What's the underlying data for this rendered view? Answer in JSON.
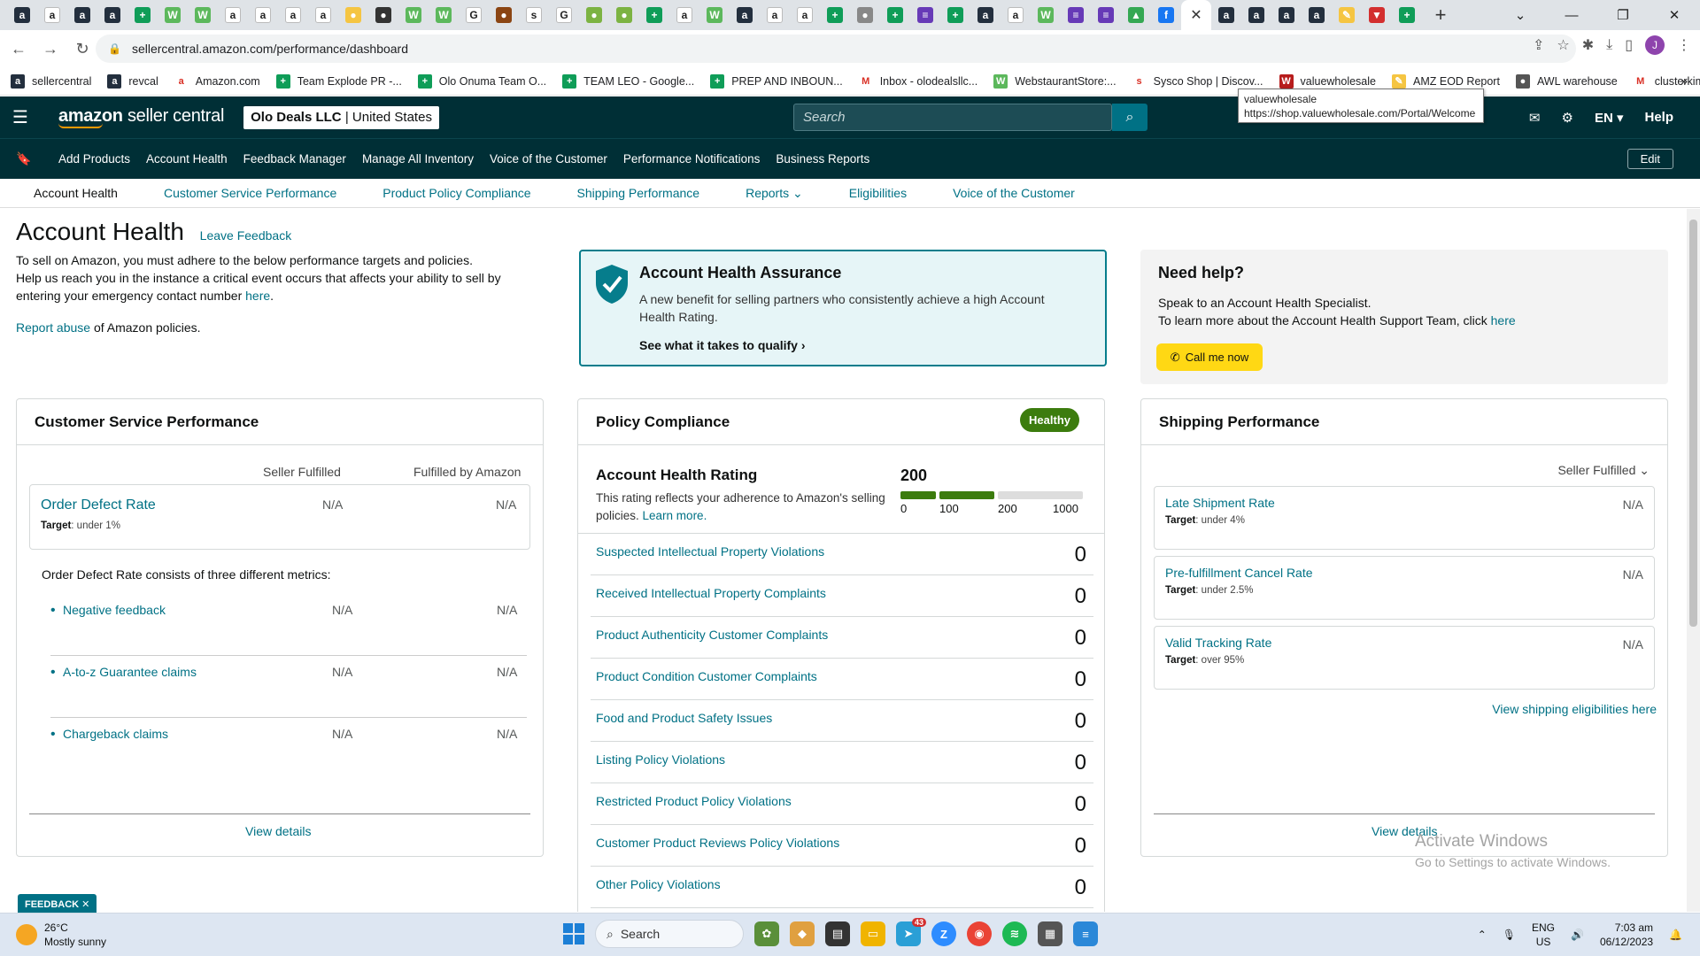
{
  "browser": {
    "url": "sellercentral.amazon.com/performance/dashboard",
    "bookmarks": [
      "sellercentral",
      "revcal",
      "Amazon.com",
      "Team Explode PR -...",
      "Olo Onuma Team O...",
      "TEAM LEO - Google...",
      "PREP AND INBOUN...",
      "Inbox - olodealsllc...",
      "WebstaurantStore:...",
      "Sysco Shop | Discov...",
      "valuewholesale",
      "AMZ EOD Report",
      "AWL warehouse",
      "clusterkimfba@gm..."
    ],
    "tooltip_title": "valuewholesale",
    "tooltip_url": "https://shop.valuewholesale.com/Portal/Welcome",
    "profile_initial": "J"
  },
  "header": {
    "logo_main": "amazon",
    "logo_sub": "seller central",
    "store": "Olo Deals LLC",
    "store_region": "| United States",
    "search_placeholder": "Search",
    "language": "EN",
    "help": "Help"
  },
  "nav": {
    "items": [
      "Add Products",
      "Account Health",
      "Feedback Manager",
      "Manage All Inventory",
      "Voice of the Customer",
      "Performance Notifications",
      "Business Reports"
    ],
    "edit": "Edit"
  },
  "subnav": {
    "items": [
      "Account Health",
      "Customer Service Performance",
      "Product Policy Compliance",
      "Shipping Performance",
      "Reports",
      "Eligibilities",
      "Voice of the Customer"
    ]
  },
  "page": {
    "title": "Account Health",
    "leave_feedback": "Leave Feedback",
    "intro_1": "To sell on Amazon, you must adhere to the below performance targets and policies.",
    "intro_2": "Help us reach you in the instance a critical event occurs that affects your ability to sell by entering your emergency contact number ",
    "intro_here": "here",
    "report_link": "Report abuse",
    "report_rest": " of Amazon policies."
  },
  "aha": {
    "title": "Account Health Assurance",
    "text": "A new benefit for selling partners who consistently achieve a high Account Health Rating.",
    "link": "See what it takes to qualify"
  },
  "help": {
    "title": "Need help?",
    "line1": "Speak to an Account Health Specialist.",
    "line2": "To learn more about the Account Health Support Team, click ",
    "here": "here",
    "button": "Call me now"
  },
  "csp": {
    "title": "Customer Service Performance",
    "col1": "Seller Fulfilled",
    "col2": "Fulfilled by Amazon",
    "odr_name": "Order Defect Rate",
    "odr_target_label": "Target",
    "odr_target": ": under 1%",
    "odr_sf": "N/A",
    "odr_fba": "N/A",
    "consists": "Order Defect Rate consists of three different metrics:",
    "metrics": [
      {
        "name": "Negative feedback",
        "sf": "N/A",
        "fba": "N/A"
      },
      {
        "name": "A-to-z Guarantee claims",
        "sf": "N/A",
        "fba": "N/A"
      },
      {
        "name": "Chargeback claims",
        "sf": "N/A",
        "fba": "N/A"
      }
    ],
    "view_details": "View details"
  },
  "policy": {
    "title": "Policy Compliance",
    "status": "Healthy",
    "status_color": "#3c7c0e",
    "ahr_title": "Account Health Rating",
    "ahr_text": "This rating reflects your adherence to Amazon's selling policies. ",
    "learn_more": "Learn more.",
    "rating": "200",
    "scale": [
      "0",
      "100",
      "200",
      "1000"
    ],
    "rows": [
      {
        "label": "Suspected Intellectual Property Violations",
        "count": "0"
      },
      {
        "label": "Received Intellectual Property Complaints",
        "count": "0"
      },
      {
        "label": "Product Authenticity Customer Complaints",
        "count": "0"
      },
      {
        "label": "Product Condition Customer Complaints",
        "count": "0"
      },
      {
        "label": "Food and Product Safety Issues",
        "count": "0"
      },
      {
        "label": "Listing Policy Violations",
        "count": "0"
      },
      {
        "label": "Restricted Product Policy Violations",
        "count": "0"
      },
      {
        "label": "Customer Product Reviews Policy Violations",
        "count": "0"
      },
      {
        "label": "Other Policy Violations",
        "count": "0"
      }
    ]
  },
  "shipping": {
    "title": "Shipping Performance",
    "selector": "Seller Fulfilled",
    "metrics": [
      {
        "name": "Late Shipment Rate",
        "target": ": under 4%",
        "value": "N/A"
      },
      {
        "name": "Pre-fulfillment Cancel Rate",
        "target": ": under 2.5%",
        "value": "N/A"
      },
      {
        "name": "Valid Tracking Rate",
        "target": ": over 95%",
        "value": "N/A"
      }
    ],
    "target_label": "Target",
    "eligibility_link": "View shipping eligibilities here",
    "view_details": "View details"
  },
  "watermark": {
    "line1": "Activate Windows",
    "line2": "Go to Settings to activate Windows."
  },
  "feedback_tab": "FEEDBACK",
  "taskbar": {
    "temp": "26°C",
    "weather": "Mostly sunny",
    "search": "Search",
    "lang1": "ENG",
    "lang2": "US",
    "time": "7:03 am",
    "date": "06/12/2023",
    "badge": "43"
  }
}
